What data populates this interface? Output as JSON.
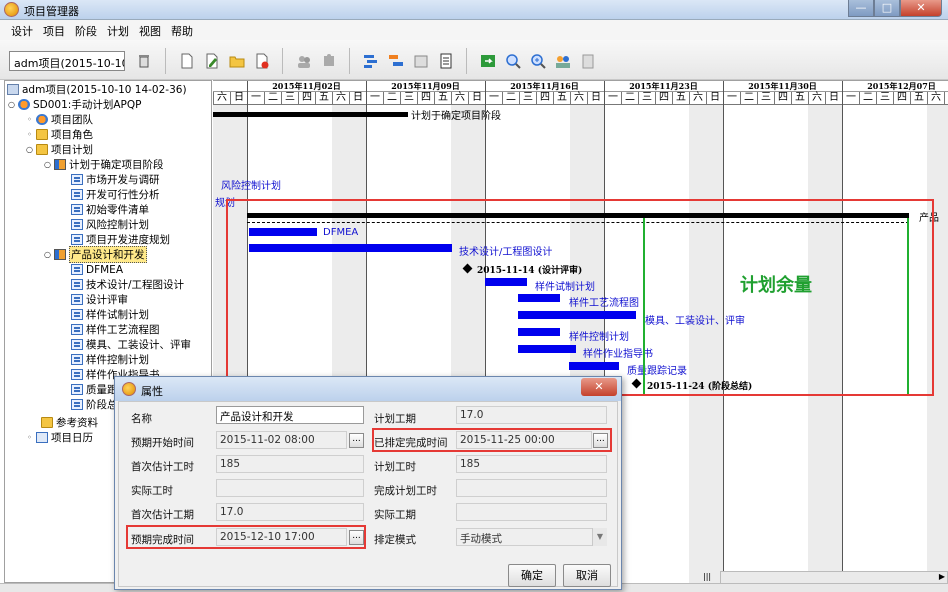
{
  "window": {
    "title": "项目管理器",
    "min": "—",
    "max": "□",
    "close": "✕"
  },
  "menu": [
    "设计",
    "项目",
    "阶段",
    "计划",
    "视图",
    "帮助"
  ],
  "toolbar": {
    "project_selector": "adm项目(2015-10-10"
  },
  "tree": {
    "root": "adm项目(2015-10-10 14-02-36)",
    "project": "SD001:手动计划APQP",
    "team": "项目团队",
    "roles": "项目角色",
    "plan": "项目计划",
    "phase1": "计划于确定项目阶段",
    "phase1_tasks": [
      "市场开发与调研",
      "开发可行性分析",
      "初始零件清单",
      "风险控制计划",
      "项目开发进度规划"
    ],
    "phase2": "产品设计和开发",
    "phase2_tasks": [
      "DFMEA",
      "技术设计/工程图设计",
      "设计评审",
      "样件试制计划",
      "样件工艺流程图",
      "模具、工装设计、评审",
      "样件控制计划",
      "样件作业指导书",
      "质量跟踪记录",
      "阶段总结"
    ],
    "references": "参考资料",
    "calendar": "项目日历"
  },
  "gantt": {
    "weeks": [
      "2015年11月02日",
      "2015年11月09日",
      "2015年11月16日",
      "2015年11月23日",
      "2015年11月30日",
      "2015年12月07日"
    ],
    "day_labels": [
      "一",
      "二",
      "三",
      "四",
      "五",
      "六",
      "日"
    ],
    "lead_days": [
      "六",
      "日"
    ],
    "labels": {
      "phase1": "计划于确定项目阶段",
      "risk": "风险控制计划",
      "plan_short": "规划",
      "phase2": "产品",
      "dfmea": "DFMEA",
      "tech": "技术设计/工程图设计",
      "milestone1": "2015-11-14 (设计评审)",
      "trial": "样件试制计划",
      "flow": "样件工艺流程图",
      "mold": "模具、工装设计、评审",
      "control": "样件控制计划",
      "guide": "样件作业指导书",
      "quality": "质量跟踪记录",
      "milestone2": "2015-11-24 (阶段总结)"
    },
    "annotation": "计划余量",
    "colors": {
      "bar": "#0000ee",
      "highlight": "#e53935",
      "buffer": "#20a030"
    }
  },
  "dialog": {
    "title": "属性",
    "close": "✕",
    "fields": {
      "name_label": "名称",
      "name_value": "产品设计和开发",
      "plan_period_label": "计划工期",
      "plan_period_value": "17.0",
      "exp_start_label": "预期开始时间",
      "exp_start_value": "2015-11-02 08:00",
      "sched_finish_label": "已排定完成时间",
      "sched_finish_value": "2015-11-25 00:00",
      "first_est_hours_label": "首次估计工时",
      "first_est_hours_value": "185",
      "plan_hours_label": "计划工时",
      "plan_hours_value": "185",
      "actual_hours_label": "实际工时",
      "actual_hours_value": "",
      "done_plan_hours_label": "完成计划工时",
      "done_plan_hours_value": "",
      "first_est_period_label": "首次估计工期",
      "first_est_period_value": "17.0",
      "actual_period_label": "实际工期",
      "actual_period_value": "",
      "exp_finish_label": "预期完成时间",
      "exp_finish_value": "2015-12-10 17:00",
      "sched_mode_label": "排定模式",
      "sched_mode_value": "手动模式"
    },
    "picker": "...",
    "ok": "确定",
    "cancel": "取消"
  },
  "scroll": {
    "thumb": "|||"
  }
}
